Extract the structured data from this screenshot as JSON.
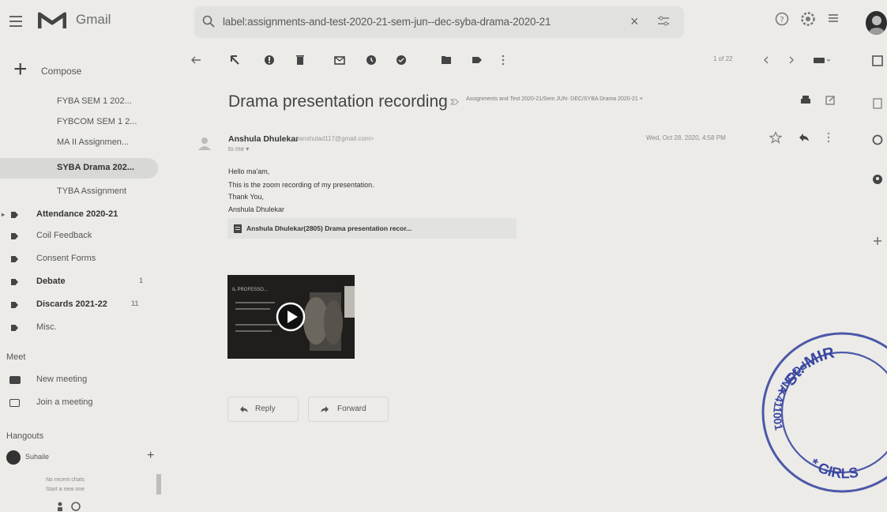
{
  "app": {
    "brand": "Gmail"
  },
  "search": {
    "query": "label:assignments-and-test-2020-21-sem-jun--dec-syba-drama-2020-21",
    "clear": "×"
  },
  "compose": {
    "label": "Compose"
  },
  "sidebar": {
    "labels": [
      {
        "label": "FYBA SEM 1 202...",
        "active": false
      },
      {
        "label": "FYBCOM SEM 1 2...",
        "active": false
      },
      {
        "label": "MA II Assignmen...",
        "active": false
      },
      {
        "label": "SYBA Drama 202...",
        "active": true
      },
      {
        "label": "TYBA Assignment",
        "active": false
      }
    ],
    "folders": [
      {
        "label": "Attendance 2020-21",
        "count": ""
      },
      {
        "label": "Coil Feedback",
        "count": ""
      },
      {
        "label": "Consent Forms",
        "count": ""
      },
      {
        "label": "Debate",
        "count": "1"
      },
      {
        "label": "Discards 2021-22",
        "count": "11"
      },
      {
        "label": "Misc.",
        "count": ""
      }
    ]
  },
  "meet": {
    "title": "Meet",
    "new_meeting": "New meeting",
    "join": "Join a meeting"
  },
  "hangouts": {
    "title": "Hangouts",
    "user": "Suhaile",
    "no_chats": "No recent chats",
    "start_chat": "Start a new one"
  },
  "toolbar": {
    "pagination": "1 of 22"
  },
  "message": {
    "subject": "Drama presentation recording",
    "label_chip": "Assignments and Test 2020-21/Sem JUN- DEC/SYBA Drama 2020-21 ×",
    "sender_name": "Anshula Dhulekar",
    "sender_email": "<anshulad117@gmail.com>",
    "to": "to me ▾",
    "date": "Wed, Oct 28, 2020, 4:58 PM",
    "body": [
      "Hello ma'am,",
      "This is the zoom recording of my presentation.",
      "Thank You,",
      "Anshula Dhulekar"
    ],
    "attachment": "Anshula Dhulekar(2805) Drama presentation recor...",
    "video_title": "IL PROFESSO..."
  },
  "actions": {
    "reply": "Reply",
    "forward": "Forward"
  },
  "stamp": {
    "top_text": "* St. MIR",
    "left_text": "POONA-411001",
    "bottom_text": "* GIRLS"
  },
  "colors": {
    "background": "#ecebe8",
    "logo_red": "#5a5a5a",
    "active_row": "#d8d8d5"
  }
}
